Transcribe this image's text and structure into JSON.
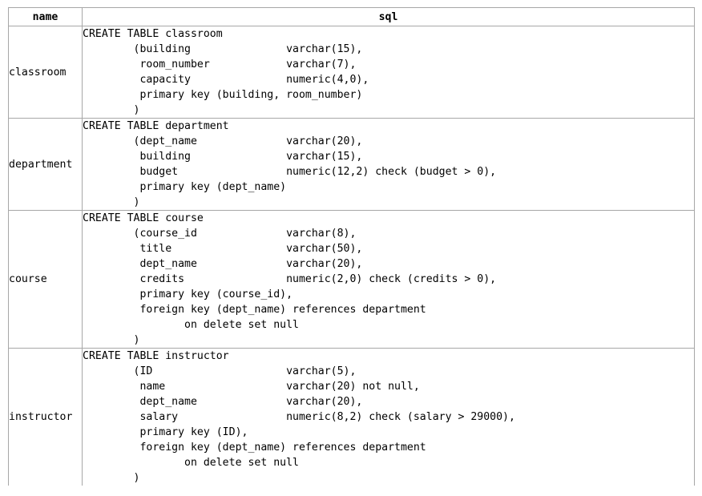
{
  "headers": {
    "name": "name",
    "sql": "sql"
  },
  "rows": [
    {
      "name": "classroom",
      "sql": "CREATE TABLE classroom\n\t(building\t\tvarchar(15),\n\t room_number\t\tvarchar(7),\n\t capacity\t\tnumeric(4,0),\n\t primary key (building, room_number)\n\t)"
    },
    {
      "name": "department",
      "sql": "CREATE TABLE department\n\t(dept_name\t\tvarchar(20),\n\t building\t\tvarchar(15),\n\t budget\t\t        numeric(12,2) check (budget > 0),\n\t primary key (dept_name)\n\t)"
    },
    {
      "name": "course",
      "sql": "CREATE TABLE course\n\t(course_id\t\tvarchar(8),\n\t title\t\t\tvarchar(50),\n\t dept_name\t\tvarchar(20),\n\t credits\t\tnumeric(2,0) check (credits > 0),\n\t primary key (course_id),\n\t foreign key (dept_name) references department\n\t\ton delete set null\n\t)"
    },
    {
      "name": "instructor",
      "sql": "CREATE TABLE instructor\n\t(ID\t\t\tvarchar(5),\n\t name\t\t\tvarchar(20) not null,\n\t dept_name\t\tvarchar(20),\n\t salary\t\t\tnumeric(8,2) check (salary > 29000),\n\t primary key (ID),\n\t foreign key (dept_name) references department\n\t\ton delete set null\n\t)"
    }
  ]
}
